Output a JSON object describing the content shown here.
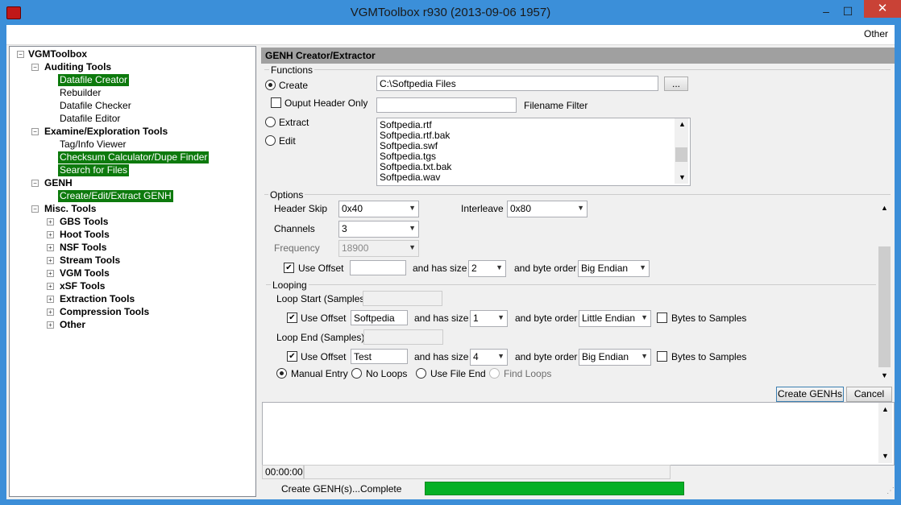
{
  "window": {
    "title": "VGMToolbox r930 (2013-09-06 1957)",
    "minimize": "–",
    "maximize": "☐",
    "close": "✕"
  },
  "menu": {
    "other": "Other"
  },
  "tree": {
    "root": "VGMToolbox",
    "auditing": "Auditing Tools",
    "datafile_creator": "Datafile Creator",
    "rebuilder": "Rebuilder",
    "datafile_checker": "Datafile Checker",
    "datafile_editor": "Datafile Editor",
    "examine": "Examine/Exploration Tools",
    "tag_viewer": "Tag/Info Viewer",
    "checksum": "Checksum Calculator/Dupe Finder",
    "search_files": "Search for Files",
    "genh": "GENH",
    "genh_create": "Create/Edit/Extract GENH",
    "misc": "Misc. Tools",
    "gbs": "GBS Tools",
    "hoot": "Hoot Tools",
    "nsf": "NSF Tools",
    "stream": "Stream Tools",
    "vgm": "VGM Tools",
    "xsf": "xSF Tools",
    "extraction": "Extraction Tools",
    "compression": "Compression Tools",
    "other": "Other"
  },
  "panel": {
    "header": "GENH Creator/Extractor",
    "functions_label": "Functions",
    "create_label": "Create",
    "path_value": "C:\\Softpedia Files",
    "browse_label": "...",
    "output_header_only": "Ouput Header Only",
    "filename_filter_value": "",
    "filename_filter_label": "Filename Filter",
    "extract_label": "Extract",
    "edit_label": "Edit",
    "files": [
      "Softpedia.rtf",
      "Softpedia.rtf.bak",
      "Softpedia.swf",
      "Softpedia.tgs",
      "Softpedia.txt.bak",
      "Softpedia.wav"
    ]
  },
  "options": {
    "label": "Options",
    "header_skip_label": "Header Skip",
    "header_skip_value": "0x40",
    "interleave_label": "Interleave",
    "interleave_value": "0x80",
    "channels_label": "Channels",
    "channels_value": "3",
    "frequency_label": "Frequency",
    "frequency_value": "18900",
    "use_offset_label": "Use Offset",
    "offset_value": "",
    "has_size_label": "and has size",
    "size_value": "2",
    "byte_order_label": "and byte order",
    "byte_order_value": "Big Endian"
  },
  "looping": {
    "label": "Looping",
    "loop_start_label": "Loop Start (Samples)",
    "start_use_offset": "Use Offset",
    "start_offset_value": "Softpedia",
    "start_has_size": "and has size",
    "start_size_value": "1",
    "start_byte_order": "and byte order",
    "start_byte_order_value": "Little Endian",
    "start_bytes_to_samples": "Bytes to Samples",
    "loop_end_label": "Loop End (Samples)",
    "end_use_offset": "Use Offset",
    "end_offset_value": "Test",
    "end_has_size": "and has size",
    "end_size_value": "4",
    "end_byte_order": "and byte order",
    "end_byte_order_value": "Big Endian",
    "end_bytes_to_samples": "Bytes to Samples",
    "manual_entry": "Manual Entry",
    "no_loops": "No Loops",
    "use_file_end": "Use File End",
    "find_loops": "Find Loops"
  },
  "actions": {
    "create_genhs": "Create GENHs",
    "cancel": "Cancel"
  },
  "status": {
    "timer": "00:00:00",
    "message": "Create GENH(s)...Complete",
    "progress": 1.0
  },
  "colors": {
    "titlebar": "#3b8fd9",
    "selection": "#0d7a0d",
    "progress": "#06b025",
    "close": "#c94236"
  },
  "icons": {
    "app": "vgmtoolbox-icon",
    "checkmark": "✔",
    "dropdown": "▾"
  }
}
